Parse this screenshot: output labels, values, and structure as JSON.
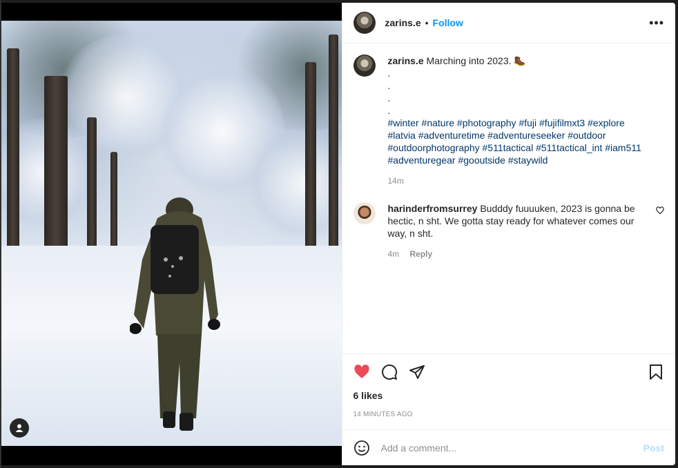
{
  "post": {
    "username": "zarins.e",
    "follow_label": "Follow",
    "more_label": "•••",
    "caption": "Marching into 2023. 🥾",
    "caption_dots": [
      ".",
      ".",
      ".",
      "."
    ],
    "hashtags_lines": [
      [
        "#winter",
        "#nature",
        "#photography",
        "#fuji",
        "#fujifilmxt3",
        "#explore"
      ],
      [
        "#latvia",
        "#adventuretime",
        "#adventureseeker",
        "#outdoor"
      ],
      [
        "#outdoorphotography",
        "#511tactical",
        "#511tactical_int",
        "#iam511"
      ],
      [
        "#adventuregear",
        "#gooutside",
        "#staywild"
      ]
    ],
    "caption_time": "14m"
  },
  "comment": {
    "username": "harinderfromsurrey",
    "text": "Budddy fuuuuken, 2023 is gonna be hectic, n sht. We gotta stay ready for whatever comes our way, n sht.",
    "time": "4m",
    "reply_label": "Reply"
  },
  "footer": {
    "likes": "6 likes",
    "timestamp": "14 MINUTES AGO",
    "comment_placeholder": "Add a comment...",
    "post_label": "Post"
  },
  "colors": {
    "link_blue": "#0095f6",
    "hashtag": "#00376b",
    "liked_red": "#ed4956",
    "post_disabled": "#b2dffc"
  }
}
